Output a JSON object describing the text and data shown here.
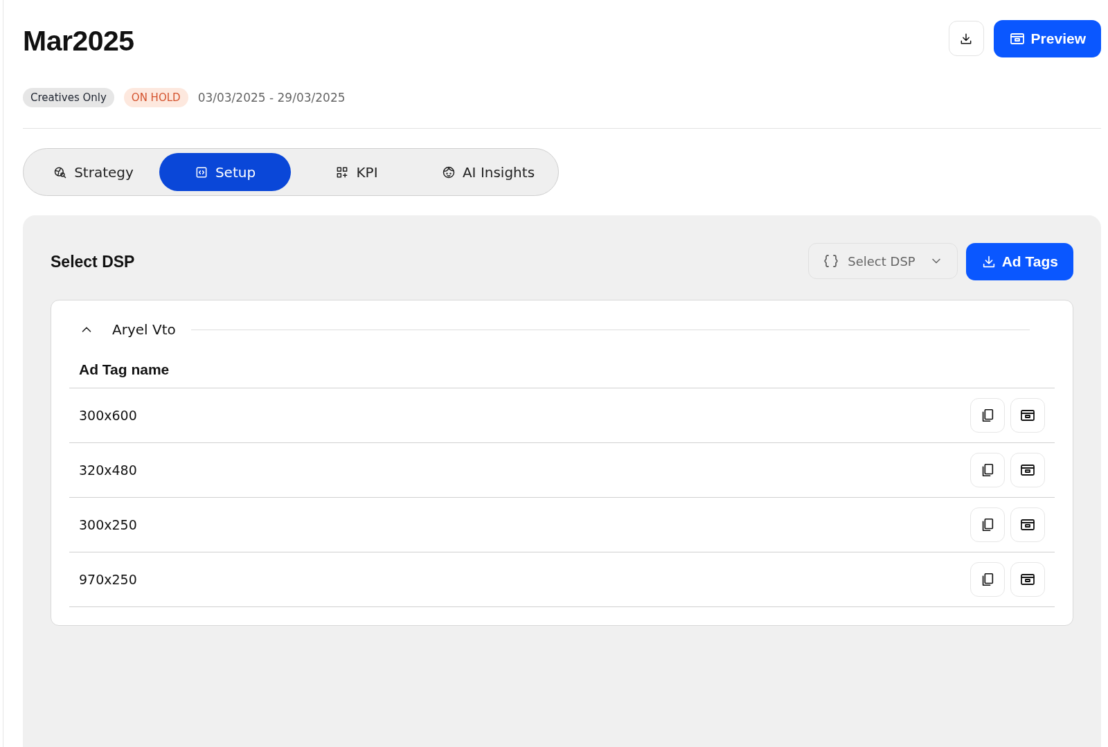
{
  "header": {
    "title": "Mar2025",
    "buttons": [
      {
        "kind": "download"
      },
      {
        "kind": "preview",
        "label": "Preview"
      }
    ]
  },
  "meta": {
    "tags": [
      {
        "label": "Creatives Only",
        "kind": "neutral"
      },
      {
        "label": "ON HOLD",
        "kind": "warning"
      }
    ],
    "date_range": "03/03/2025 - 29/03/2025"
  },
  "tabs": [
    {
      "label": "Strategy",
      "selected": false
    },
    {
      "label": "Setup",
      "selected": true
    },
    {
      "label": "KPI",
      "selected": false
    },
    {
      "label": "AI Insights",
      "selected": false
    }
  ],
  "panel": {
    "title": "Select DSP",
    "dsp_select": {
      "placeholder": "Select DSP"
    },
    "ad_tags_button": "Ad Tags",
    "group": {
      "name": "Aryel Vto",
      "expanded": true,
      "column": "Ad Tag name",
      "rows": [
        {
          "name": "300x600"
        },
        {
          "name": "320x480"
        },
        {
          "name": "300x250"
        },
        {
          "name": "970x250"
        }
      ]
    }
  }
}
